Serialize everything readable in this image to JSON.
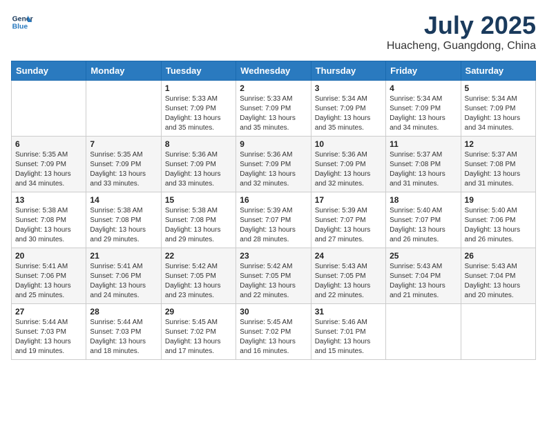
{
  "header": {
    "logo_line1": "General",
    "logo_line2": "Blue",
    "month": "July 2025",
    "location": "Huacheng, Guangdong, China"
  },
  "weekdays": [
    "Sunday",
    "Monday",
    "Tuesday",
    "Wednesday",
    "Thursday",
    "Friday",
    "Saturday"
  ],
  "weeks": [
    [
      {
        "day": "",
        "info": ""
      },
      {
        "day": "",
        "info": ""
      },
      {
        "day": "1",
        "info": "Sunrise: 5:33 AM\nSunset: 7:09 PM\nDaylight: 13 hours and 35 minutes."
      },
      {
        "day": "2",
        "info": "Sunrise: 5:33 AM\nSunset: 7:09 PM\nDaylight: 13 hours and 35 minutes."
      },
      {
        "day": "3",
        "info": "Sunrise: 5:34 AM\nSunset: 7:09 PM\nDaylight: 13 hours and 35 minutes."
      },
      {
        "day": "4",
        "info": "Sunrise: 5:34 AM\nSunset: 7:09 PM\nDaylight: 13 hours and 34 minutes."
      },
      {
        "day": "5",
        "info": "Sunrise: 5:34 AM\nSunset: 7:09 PM\nDaylight: 13 hours and 34 minutes."
      }
    ],
    [
      {
        "day": "6",
        "info": "Sunrise: 5:35 AM\nSunset: 7:09 PM\nDaylight: 13 hours and 34 minutes."
      },
      {
        "day": "7",
        "info": "Sunrise: 5:35 AM\nSunset: 7:09 PM\nDaylight: 13 hours and 33 minutes."
      },
      {
        "day": "8",
        "info": "Sunrise: 5:36 AM\nSunset: 7:09 PM\nDaylight: 13 hours and 33 minutes."
      },
      {
        "day": "9",
        "info": "Sunrise: 5:36 AM\nSunset: 7:09 PM\nDaylight: 13 hours and 32 minutes."
      },
      {
        "day": "10",
        "info": "Sunrise: 5:36 AM\nSunset: 7:09 PM\nDaylight: 13 hours and 32 minutes."
      },
      {
        "day": "11",
        "info": "Sunrise: 5:37 AM\nSunset: 7:08 PM\nDaylight: 13 hours and 31 minutes."
      },
      {
        "day": "12",
        "info": "Sunrise: 5:37 AM\nSunset: 7:08 PM\nDaylight: 13 hours and 31 minutes."
      }
    ],
    [
      {
        "day": "13",
        "info": "Sunrise: 5:38 AM\nSunset: 7:08 PM\nDaylight: 13 hours and 30 minutes."
      },
      {
        "day": "14",
        "info": "Sunrise: 5:38 AM\nSunset: 7:08 PM\nDaylight: 13 hours and 29 minutes."
      },
      {
        "day": "15",
        "info": "Sunrise: 5:38 AM\nSunset: 7:08 PM\nDaylight: 13 hours and 29 minutes."
      },
      {
        "day": "16",
        "info": "Sunrise: 5:39 AM\nSunset: 7:07 PM\nDaylight: 13 hours and 28 minutes."
      },
      {
        "day": "17",
        "info": "Sunrise: 5:39 AM\nSunset: 7:07 PM\nDaylight: 13 hours and 27 minutes."
      },
      {
        "day": "18",
        "info": "Sunrise: 5:40 AM\nSunset: 7:07 PM\nDaylight: 13 hours and 26 minutes."
      },
      {
        "day": "19",
        "info": "Sunrise: 5:40 AM\nSunset: 7:06 PM\nDaylight: 13 hours and 26 minutes."
      }
    ],
    [
      {
        "day": "20",
        "info": "Sunrise: 5:41 AM\nSunset: 7:06 PM\nDaylight: 13 hours and 25 minutes."
      },
      {
        "day": "21",
        "info": "Sunrise: 5:41 AM\nSunset: 7:06 PM\nDaylight: 13 hours and 24 minutes."
      },
      {
        "day": "22",
        "info": "Sunrise: 5:42 AM\nSunset: 7:05 PM\nDaylight: 13 hours and 23 minutes."
      },
      {
        "day": "23",
        "info": "Sunrise: 5:42 AM\nSunset: 7:05 PM\nDaylight: 13 hours and 22 minutes."
      },
      {
        "day": "24",
        "info": "Sunrise: 5:43 AM\nSunset: 7:05 PM\nDaylight: 13 hours and 22 minutes."
      },
      {
        "day": "25",
        "info": "Sunrise: 5:43 AM\nSunset: 7:04 PM\nDaylight: 13 hours and 21 minutes."
      },
      {
        "day": "26",
        "info": "Sunrise: 5:43 AM\nSunset: 7:04 PM\nDaylight: 13 hours and 20 minutes."
      }
    ],
    [
      {
        "day": "27",
        "info": "Sunrise: 5:44 AM\nSunset: 7:03 PM\nDaylight: 13 hours and 19 minutes."
      },
      {
        "day": "28",
        "info": "Sunrise: 5:44 AM\nSunset: 7:03 PM\nDaylight: 13 hours and 18 minutes."
      },
      {
        "day": "29",
        "info": "Sunrise: 5:45 AM\nSunset: 7:02 PM\nDaylight: 13 hours and 17 minutes."
      },
      {
        "day": "30",
        "info": "Sunrise: 5:45 AM\nSunset: 7:02 PM\nDaylight: 13 hours and 16 minutes."
      },
      {
        "day": "31",
        "info": "Sunrise: 5:46 AM\nSunset: 7:01 PM\nDaylight: 13 hours and 15 minutes."
      },
      {
        "day": "",
        "info": ""
      },
      {
        "day": "",
        "info": ""
      }
    ]
  ]
}
